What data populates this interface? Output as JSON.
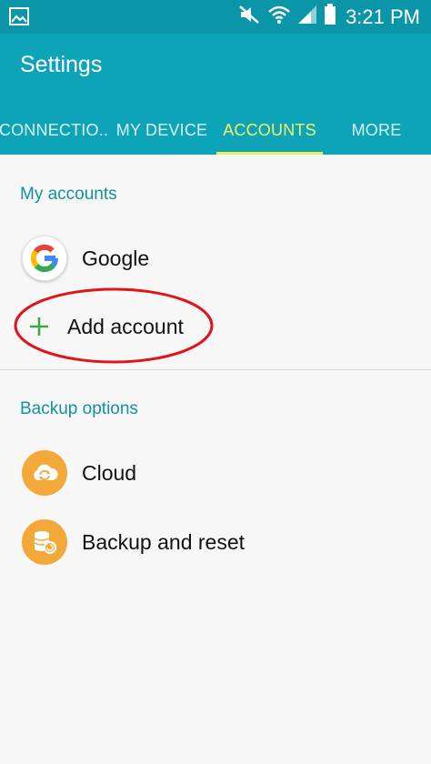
{
  "status_bar": {
    "time": "3:21 PM",
    "icons": [
      "gallery-icon",
      "mute-icon",
      "wifi-icon",
      "signal-icon",
      "battery-icon"
    ]
  },
  "header": {
    "title": "Settings"
  },
  "tabs": [
    {
      "label": "CONNECTIO..",
      "active": false
    },
    {
      "label": "MY DEVICE",
      "active": false
    },
    {
      "label": "ACCOUNTS",
      "active": true
    },
    {
      "label": "MORE",
      "active": false
    }
  ],
  "my_accounts": {
    "header": "My accounts",
    "items": [
      {
        "label": "Google",
        "icon": "google-icon"
      },
      {
        "label": "Add account",
        "icon": "plus-icon"
      }
    ]
  },
  "backup_options": {
    "header": "Backup options",
    "items": [
      {
        "label": "Cloud",
        "icon": "cloud-sync-icon"
      },
      {
        "label": "Backup and reset",
        "icon": "backup-database-icon"
      }
    ]
  },
  "colors": {
    "status_bar": "#0a95a8",
    "app_bar": "#0ea4b8",
    "active_tab": "#ecf36b",
    "section_header": "#1291a3",
    "plus": "#3da84a",
    "icon_orange": "#f3a93a",
    "annotation_circle": "#e0141b"
  }
}
